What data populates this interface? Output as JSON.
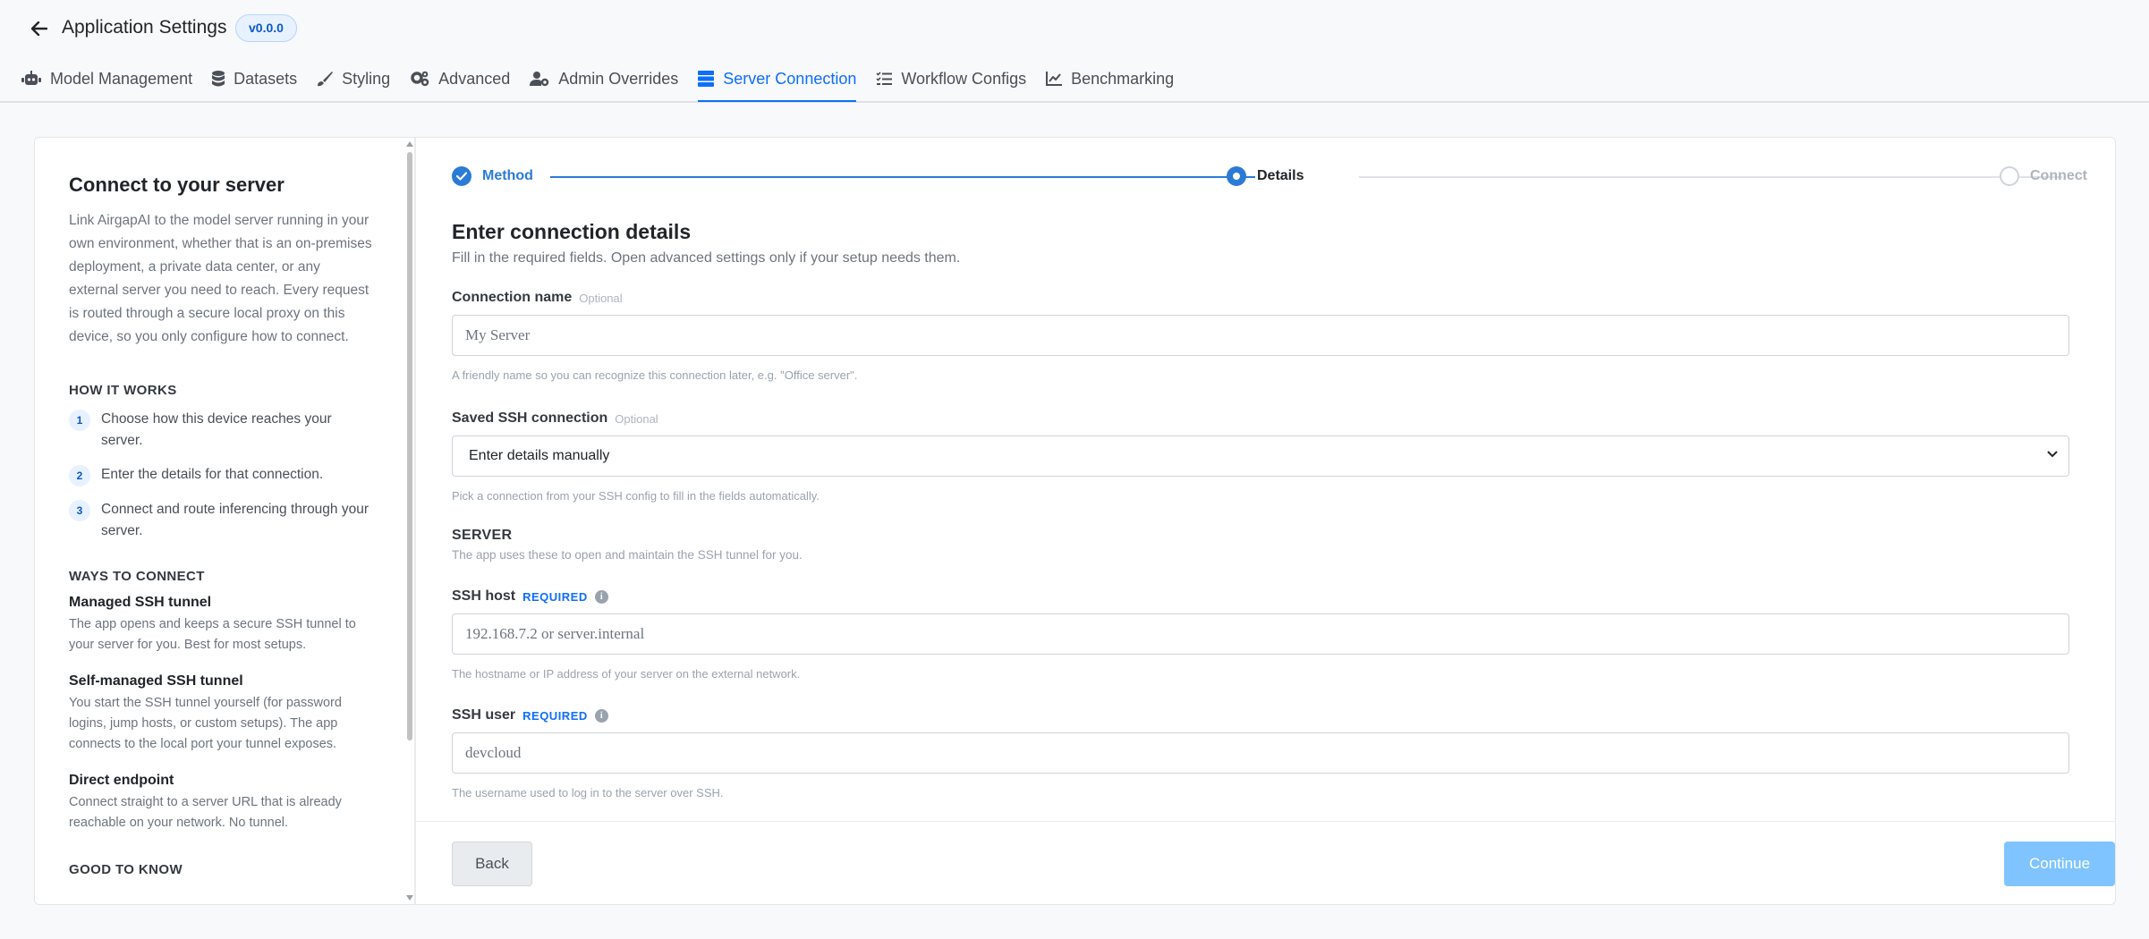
{
  "header": {
    "title": "Application Settings",
    "version": "v0.0.0",
    "back_icon": "arrow-left-icon"
  },
  "tabs": [
    {
      "label": "Model Management",
      "icon": "robot-icon"
    },
    {
      "label": "Datasets",
      "icon": "database-icon"
    },
    {
      "label": "Styling",
      "icon": "brush-icon"
    },
    {
      "label": "Advanced",
      "icon": "gears-icon"
    },
    {
      "label": "Admin Overrides",
      "icon": "user-gear-icon"
    },
    {
      "label": "Server Connection",
      "icon": "server-icon",
      "active": true
    },
    {
      "label": "Workflow Configs",
      "icon": "list-check-icon"
    },
    {
      "label": "Benchmarking",
      "icon": "chart-line-icon"
    }
  ],
  "left": {
    "title": "Connect to your server",
    "description": "Link AirgapAI to the model server running in your own environment, whether that is an on-premises deployment, a private data center, or any external server you need to reach. Every request is routed through a secure local proxy on this device, so you only configure how to connect.",
    "how_it_works_heading": "HOW IT WORKS",
    "steps": [
      {
        "num": "1",
        "text": "Choose how this device reaches your server."
      },
      {
        "num": "2",
        "text": "Enter the details for that connection."
      },
      {
        "num": "3",
        "text": "Connect and route inferencing through your server."
      }
    ],
    "ways_heading": "WAYS TO CONNECT",
    "ways": [
      {
        "title": "Managed SSH tunnel",
        "desc": "The app opens and keeps a secure SSH tunnel to your server for you. Best for most setups."
      },
      {
        "title": "Self-managed SSH tunnel",
        "desc": "You start the SSH tunnel yourself (for password logins, jump hosts, or custom setups). The app connects to the local port your tunnel exposes."
      },
      {
        "title": "Direct endpoint",
        "desc": "Connect straight to a server URL that is already reachable on your network. No tunnel."
      }
    ],
    "good_to_know_heading": "GOOD TO KNOW"
  },
  "stepper": {
    "steps": [
      {
        "label": "Method",
        "state": "complete"
      },
      {
        "label": "Details",
        "state": "current"
      },
      {
        "label": "Connect",
        "state": "upcoming"
      }
    ],
    "colors": {
      "active": "#2b7bd6",
      "inactive": "#ced4da"
    }
  },
  "form": {
    "title": "Enter connection details",
    "subtitle": "Fill in the required fields. Open advanced settings only if your setup needs them.",
    "connection_name": {
      "label": "Connection name",
      "tag": "Optional",
      "placeholder": "My Server",
      "hint": "A friendly name so you can recognize this connection later, e.g. \"Office server\"."
    },
    "saved_ssh": {
      "label": "Saved SSH connection",
      "tag": "Optional",
      "selected": "Enter details manually",
      "hint": "Pick a connection from your SSH config to fill in the fields automatically."
    },
    "server_section": {
      "heading": "SERVER",
      "sub": "The app uses these to open and maintain the SSH tunnel for you."
    },
    "ssh_host": {
      "label": "SSH host",
      "tag": "REQUIRED",
      "placeholder": "192.168.7.2 or server.internal",
      "hint": "The hostname or IP address of your server on the external network."
    },
    "ssh_user": {
      "label": "SSH user",
      "tag": "REQUIRED",
      "value": "devcloud",
      "hint": "The username used to log in to the server over SSH."
    }
  },
  "footer": {
    "back_label": "Back",
    "continue_label": "Continue"
  }
}
